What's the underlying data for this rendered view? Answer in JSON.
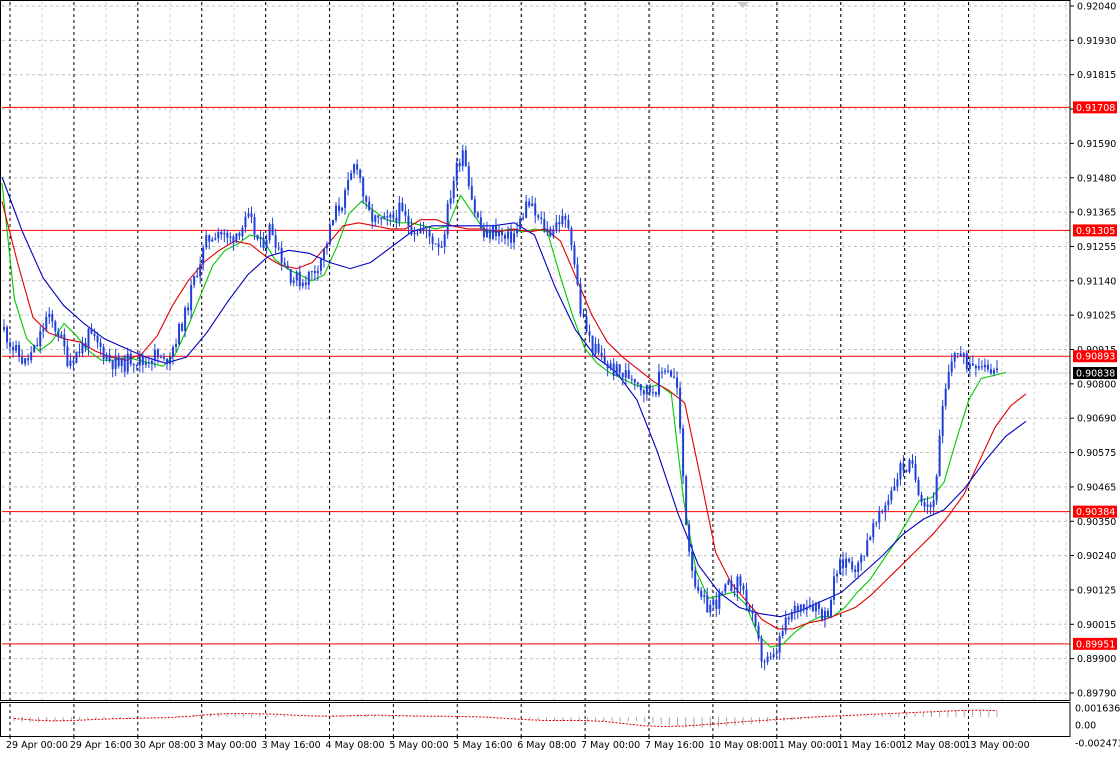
{
  "chart_data": {
    "type": "candlestick",
    "price_axis": {
      "ticks": [
        "0.92040",
        "0.91930",
        "0.91815",
        "0.91705",
        "0.91590",
        "0.91480",
        "0.91365",
        "0.91255",
        "0.91140",
        "0.91025",
        "0.90915",
        "0.90800",
        "0.90690",
        "0.90575",
        "0.90465",
        "0.90350",
        "0.90240",
        "0.90125",
        "0.90015",
        "0.89900",
        "0.89790"
      ],
      "ylim": [
        0.8979,
        0.9204
      ]
    },
    "time_axis": {
      "ticks": [
        "29 Apr 00:00",
        "29 Apr 16:00",
        "30 Apr 08:00",
        "3 May 00:00",
        "3 May 16:00",
        "4 May 08:00",
        "5 May 00:00",
        "5 May 16:00",
        "6 May 08:00",
        "7 May 00:00",
        "7 May 16:00",
        "10 May 08:00",
        "11 May 00:00",
        "11 May 16:00",
        "12 May 08:00",
        "13 May 00:00"
      ]
    },
    "levels": [
      {
        "label": "0.91708",
        "value": 0.91708,
        "color": "#ff0000"
      },
      {
        "label": "0.91305",
        "value": 0.91305,
        "color": "#ff0000"
      },
      {
        "label": "0.90893",
        "value": 0.90893,
        "color": "#ff0000"
      },
      {
        "label": "0.90384",
        "value": 0.90384,
        "color": "#ff0000"
      },
      {
        "label": "0.89951",
        "value": 0.89951,
        "color": "#ff0000"
      }
    ],
    "current_price": {
      "label": "0.90838",
      "value": 0.90838
    },
    "series": [
      {
        "name": "price",
        "values": [
          0.9098,
          0.9091,
          0.9087,
          0.9092,
          0.9102,
          0.9098,
          0.9088,
          0.9091,
          0.9096,
          0.9092,
          0.9088,
          0.9086,
          0.9089,
          0.9087,
          0.909,
          0.9087,
          0.9094,
          0.9103,
          0.9117,
          0.9127,
          0.9131,
          0.9127,
          0.9131,
          0.9134,
          0.9125,
          0.9132,
          0.9122,
          0.9115,
          0.9114,
          0.9117,
          0.9124,
          0.9136,
          0.9142,
          0.9154,
          0.9136,
          0.9133,
          0.9133,
          0.9137,
          0.9132,
          0.9131,
          0.9128,
          0.9126,
          0.9146,
          0.9158,
          0.9138,
          0.9128,
          0.9131,
          0.9127,
          0.913,
          0.914,
          0.9134,
          0.913,
          0.9134,
          0.9132,
          0.9104,
          0.9093,
          0.9088,
          0.9085,
          0.9083,
          0.9083,
          0.9078,
          0.9079,
          0.9087,
          0.908,
          0.903,
          0.901,
          0.9007,
          0.901,
          0.9014,
          0.9015,
          0.9004,
          0.899,
          0.8989,
          0.9,
          0.9006,
          0.9009,
          0.9008,
          0.9004,
          0.9019,
          0.9023,
          0.902,
          0.9031,
          0.9036,
          0.9045,
          0.9053,
          0.9053,
          0.9043,
          0.904,
          0.9074,
          0.9092,
          0.9087,
          0.9088,
          0.9087,
          0.9084
        ]
      },
      {
        "name": "ma-fast",
        "values": [
          0.9146,
          0.9108,
          0.9095,
          0.9091,
          0.9094,
          0.91,
          0.9096,
          0.9091,
          0.9088,
          0.9088,
          0.9089,
          0.9088,
          0.9087,
          0.9086,
          0.909,
          0.9099,
          0.9109,
          0.9119,
          0.9124,
          0.9126,
          0.9129,
          0.9128,
          0.9121,
          0.9118,
          0.9116,
          0.9114,
          0.9116,
          0.9125,
          0.9136,
          0.914,
          0.9137,
          0.9134,
          0.9133,
          0.9133,
          0.9132,
          0.9131,
          0.9132,
          0.9142,
          0.9136,
          0.913,
          0.913,
          0.9131,
          0.913,
          0.9131,
          0.913,
          0.9116,
          0.9103,
          0.9092,
          0.9087,
          0.9084,
          0.9082,
          0.908,
          0.9079,
          0.908,
          0.9077,
          0.9042,
          0.9019,
          0.901,
          0.9011,
          0.9012,
          0.9008,
          0.8998,
          0.8994,
          0.8995,
          0.8999,
          0.9002,
          0.9004,
          0.9004,
          0.9007,
          0.9012,
          0.9016,
          0.9022,
          0.9028,
          0.9035,
          0.9042,
          0.9043,
          0.9048,
          0.9062,
          0.9075,
          0.9082,
          0.9083,
          0.9084
        ]
      },
      {
        "name": "ma-mid",
        "values": [
          0.914,
          0.912,
          0.9102,
          0.9097,
          0.9095,
          0.9094,
          0.9091,
          0.9089,
          0.9088,
          0.909,
          0.9096,
          0.9106,
          0.9114,
          0.912,
          0.9124,
          0.9127,
          0.9126,
          0.9122,
          0.9119,
          0.9118,
          0.912,
          0.9126,
          0.9132,
          0.9133,
          0.9132,
          0.9131,
          0.9131,
          0.9134,
          0.9134,
          0.9132,
          0.9131,
          0.9131,
          0.913,
          0.9131,
          0.913,
          0.9131,
          0.9127,
          0.9115,
          0.9103,
          0.9094,
          0.9089,
          0.9085,
          0.9081,
          0.9078,
          0.9074,
          0.905,
          0.9025,
          0.9015,
          0.9009,
          0.9003,
          0.9,
          0.9,
          0.9002,
          0.9003,
          0.9005,
          0.9007,
          0.9011,
          0.9016,
          0.9021,
          0.9026,
          0.9031,
          0.9037,
          0.9044,
          0.9055,
          0.9066,
          0.9073,
          0.9077
        ]
      },
      {
        "name": "ma-slow",
        "values": [
          0.9148,
          0.913,
          0.9115,
          0.9106,
          0.91,
          0.9095,
          0.9092,
          0.9089,
          0.9087,
          0.9089,
          0.9097,
          0.9107,
          0.9116,
          0.9122,
          0.9124,
          0.9123,
          0.912,
          0.9118,
          0.912,
          0.9125,
          0.913,
          0.9132,
          0.9132,
          0.9132,
          0.9132,
          0.9133,
          0.9129,
          0.9112,
          0.9098,
          0.9089,
          0.9084,
          0.9075,
          0.9058,
          0.9038,
          0.9021,
          0.9012,
          0.9007,
          0.9005,
          0.9004,
          0.9006,
          0.9009,
          0.9012,
          0.9018,
          0.9024,
          0.9031,
          0.9036,
          0.9039,
          0.9046,
          0.9055,
          0.9063,
          0.9068
        ]
      }
    ],
    "oscillator": {
      "ticks": [
        "0.001636",
        "0.00",
        "-0.002473"
      ],
      "ylim": [
        -0.003,
        0.0021
      ],
      "histogram": [
        -0.001,
        -0.0012,
        -0.0011,
        -0.0009,
        -0.0007,
        -0.0005,
        -0.0004,
        -0.0003,
        -0.0002,
        0.0,
        0.0003,
        0.0007,
        0.0009,
        0.001,
        0.0009,
        0.0007,
        0.0004,
        0.0002,
        0.0001,
        0.0003,
        0.0005,
        0.0006,
        0.0005,
        0.0004,
        0.0003,
        0.0002,
        0.0002,
        0.0002,
        0.0002,
        0.0001,
        0.0,
        -0.0004,
        -0.0007,
        -0.0009,
        -0.001,
        -0.0011,
        -0.001,
        -0.001,
        -0.001,
        -0.0013,
        -0.0019,
        -0.0024,
        -0.0025,
        -0.0023,
        -0.002,
        -0.0017,
        -0.0013,
        -0.0009,
        -0.0006,
        -0.0003,
        0.0,
        0.0002,
        0.0004,
        0.0006,
        0.0008,
        0.001,
        0.0012,
        0.0015,
        0.0017,
        0.0016,
        0.0013
      ],
      "signal": [
        -0.0003,
        -0.0007,
        -0.0009,
        -0.0008,
        -0.0006,
        -0.0004,
        -0.0003,
        -0.0002,
        -0.0001,
        0.0002,
        0.0006,
        0.0008,
        0.0008,
        0.0007,
        0.0005,
        0.0003,
        0.0002,
        0.0003,
        0.0004,
        0.0004,
        0.0003,
        0.0002,
        0.0002,
        0.0001,
        0.0,
        -0.0003,
        -0.0006,
        -0.0008,
        -0.0008,
        -0.0008,
        -0.001,
        -0.0015,
        -0.002,
        -0.0022,
        -0.0021,
        -0.0018,
        -0.0015,
        -0.0011,
        -0.0008,
        -0.0005,
        -0.0002,
        0.0001,
        0.0003,
        0.0005,
        0.0007,
        0.0009,
        0.0011,
        0.0013,
        0.0015,
        0.0016,
        0.0015
      ]
    },
    "colors": {
      "candle": "#1f3fd8",
      "ma-fast": "#00c800",
      "ma-mid": "#e00000",
      "ma-slow": "#0000c0",
      "level": "#ff0000",
      "grid": "#c0c0c0",
      "histogram": "#a8a8a8",
      "signal": "#e00000",
      "current_bg": "#000000"
    }
  }
}
